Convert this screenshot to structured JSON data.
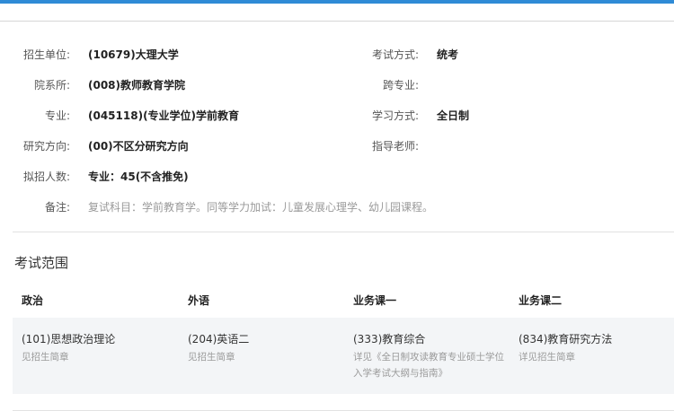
{
  "info": {
    "unit_label": "招生单位:",
    "unit_value": "(10679)大理大学",
    "exam_mode_label": "考试方式:",
    "exam_mode_value": "统考",
    "department_label": "院系所:",
    "department_value": "(008)教师教育学院",
    "cross_major_label": "跨专业:",
    "cross_major_value": "",
    "major_label": "专业:",
    "major_value": "(045118)(专业学位)学前教育",
    "study_mode_label": "学习方式:",
    "study_mode_value": "全日制",
    "direction_label": "研究方向:",
    "direction_value": "(00)不区分研究方向",
    "advisor_label": "指导老师:",
    "advisor_value": "",
    "quota_label": "拟招人数:",
    "quota_value": "专业：45(不含推免)",
    "note_label": "备注:",
    "note_value": "复试科目：学前教育学。同等学力加试：儿童发展心理学、幼儿园课程。"
  },
  "exam_scope": {
    "title": "考试范围",
    "headers": [
      "政治",
      "外语",
      "业务课一",
      "业务课二"
    ],
    "cells": [
      {
        "name": "(101)思想政治理论",
        "sub": "见招生简章"
      },
      {
        "name": "(204)英语二",
        "sub": "见招生简章"
      },
      {
        "name": "(333)教育综合",
        "sub": "详见《全日制攻读教育专业硕士学位入学考试大纲与指南》"
      },
      {
        "name": "(834)教育研究方法",
        "sub": "详见招生简章"
      }
    ]
  },
  "colors": {
    "accent": "#2f8bd6",
    "table_bg": "#f3f5f7",
    "muted_text": "#9a9a9a"
  }
}
